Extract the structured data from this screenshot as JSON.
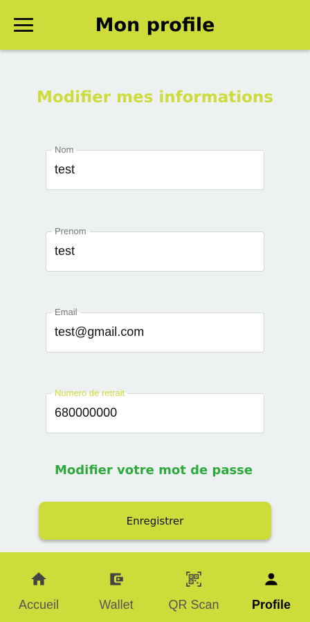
{
  "appbar": {
    "title": "Mon profile",
    "menu_icon": "hamburger-menu-icon"
  },
  "form": {
    "title": "Modifier mes informations",
    "fields": [
      {
        "label": "Nom",
        "value": "test"
      },
      {
        "label": "Prenom",
        "value": "test"
      },
      {
        "label": "Email",
        "value": "test@gmail.com"
      },
      {
        "label": "Numero de retrait",
        "value": "680000000"
      }
    ],
    "change_password": "Modifier votre mot de passe",
    "save": "Enregistrer"
  },
  "nav": {
    "items": [
      {
        "label": "Accueil",
        "icon": "home-icon"
      },
      {
        "label": "Wallet",
        "icon": "wallet-icon"
      },
      {
        "label": "QR Scan",
        "icon": "qr-scan-icon"
      },
      {
        "label": "Profile",
        "icon": "person-icon",
        "active": true
      }
    ]
  },
  "colors": {
    "accent": "#cddc3a",
    "link": "#2eaa3d",
    "background": "#eef1f1"
  }
}
